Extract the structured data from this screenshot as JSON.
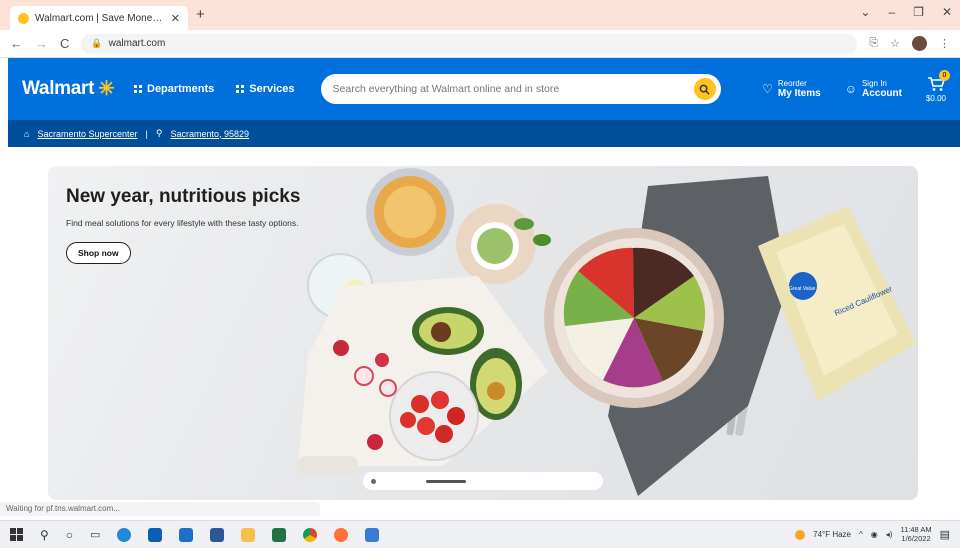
{
  "browser": {
    "tab_title": "Walmart.com | Save Money. Live",
    "close_tab": "✕",
    "new_tab": "+",
    "url": "walmart.com",
    "win_min": "⌄",
    "win_min2": "–",
    "win_max": "❐",
    "win_close": "✕"
  },
  "header": {
    "logo": "Walmart",
    "departments": "Departments",
    "services": "Services",
    "search_placeholder": "Search everything at Walmart online and in store",
    "reorder_small": "Reorder",
    "reorder_big": "My Items",
    "signin_small": "Sign In",
    "signin_big": "Account",
    "cart_count": "0",
    "cart_label": "$0.00"
  },
  "subbar": {
    "store": "Sacramento Supercenter",
    "separator": "|",
    "location": "Sacramento, 95829"
  },
  "hero": {
    "title": "New year, nutritious picks",
    "subtitle": "Find meal solutions for every lifestyle with these tasty options.",
    "button": "Shop now",
    "package_brand": "Great Value",
    "package_text": "Riced Cauliflower"
  },
  "status_bar": "Waiting for pf.tns.walmart.com...",
  "taskbar": {
    "weather": "74°F Haze",
    "time": "11:48 AM",
    "date": "1/6/2022"
  },
  "colors": {
    "walmart_blue": "#0071dc",
    "walmart_dark_blue": "#004f9a",
    "spark_yellow": "#ffc220"
  }
}
